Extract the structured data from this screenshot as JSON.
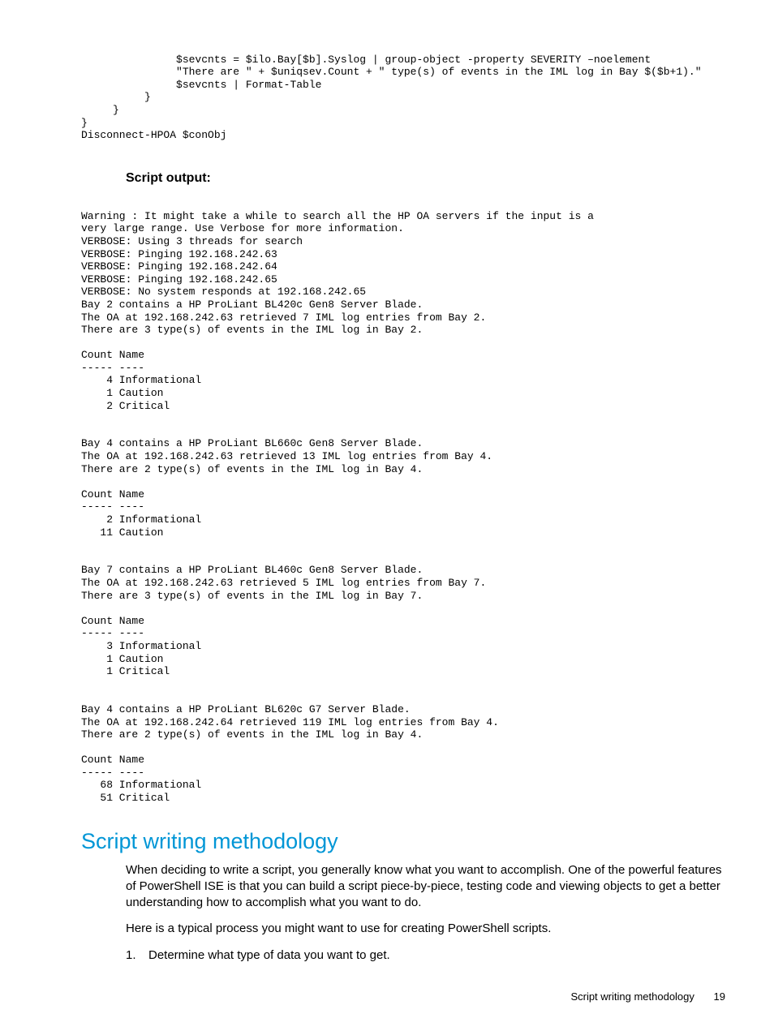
{
  "code": {
    "line1": "               $sevcnts = $ilo.Bay[$b].Syslog | group-object -property SEVERITY –noelement",
    "line2": "               \"There are \" + $uniqsev.Count + \" type(s) of events in the IML log in Bay $($b+1).\"",
    "line3": "               $sevcnts | Format-Table",
    "line4": "          }",
    "line5": "     }",
    "line6": "}",
    "line7": "Disconnect-HPOA $conObj"
  },
  "script_output_heading": "Script output:",
  "output": {
    "block": "Warning : It might take a while to search all the HP OA servers if the input is a\nvery large range. Use Verbose for more information.\nVERBOSE: Using 3 threads for search\nVERBOSE: Pinging 192.168.242.63\nVERBOSE: Pinging 192.168.242.64\nVERBOSE: Pinging 192.168.242.65\nVERBOSE: No system responds at 192.168.242.65\nBay 2 contains a HP ProLiant BL420c Gen8 Server Blade.\nThe OA at 192.168.242.63 retrieved 7 IML log entries from Bay 2.\nThere are 3 type(s) of events in the IML log in Bay 2.\n\nCount Name\n----- ----\n    4 Informational\n    1 Caution\n    2 Critical\n\n\nBay 4 contains a HP ProLiant BL660c Gen8 Server Blade.\nThe OA at 192.168.242.63 retrieved 13 IML log entries from Bay 4.\nThere are 2 type(s) of events in the IML log in Bay 4.\n\nCount Name\n----- ----\n    2 Informational\n   11 Caution\n\n\nBay 7 contains a HP ProLiant BL460c Gen8 Server Blade.\nThe OA at 192.168.242.63 retrieved 5 IML log entries from Bay 7.\nThere are 3 type(s) of events in the IML log in Bay 7.\n\nCount Name\n----- ----\n    3 Informational\n    1 Caution\n    1 Critical\n\n\nBay 4 contains a HP ProLiant BL620c G7 Server Blade.\nThe OA at 192.168.242.64 retrieved 119 IML log entries from Bay 4.\nThere are 2 type(s) of events in the IML log in Bay 4.\n\nCount Name\n----- ----\n   68 Informational\n   51 Critical"
  },
  "section_heading": "Script writing methodology",
  "body": {
    "p1": "When deciding to write a script, you generally know what you want to accomplish. One of the powerful features of PowerShell ISE is that you can build a script piece-by-piece, testing code and viewing objects to get a better understanding how to accomplish what you want to do.",
    "p2": "Here is a typical process you might want to use for creating PowerShell scripts."
  },
  "list": {
    "num1": "1.",
    "item1": "Determine what type of data you want to get."
  },
  "footer": {
    "label": "Script writing methodology",
    "page": "19"
  }
}
